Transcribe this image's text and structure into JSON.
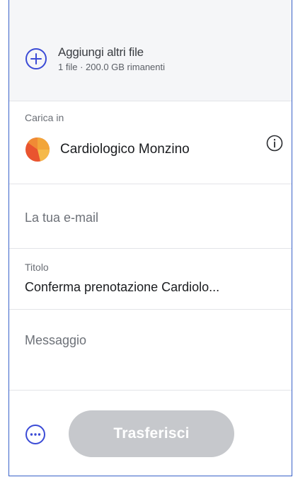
{
  "upload": {
    "add_title": "Aggiungi altri file",
    "add_subtitle": "1 file · 200.0 GB rimanenti",
    "accent_color": "#3b4bd6"
  },
  "destination": {
    "label": "Carica in",
    "name": "Cardiologico Monzino",
    "info_icon": "info-icon"
  },
  "email": {
    "placeholder": "La tua e-mail",
    "value": ""
  },
  "title_field": {
    "label": "Titolo",
    "value": "Conferma prenotazione Cardiolo..."
  },
  "message": {
    "placeholder": "Messaggio",
    "value": ""
  },
  "footer": {
    "more_icon": "more-options-icon",
    "transfer_label": "Trasferisci",
    "transfer_color": "#c6c8cc"
  }
}
